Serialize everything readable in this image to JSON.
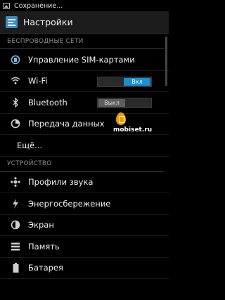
{
  "statusbar": {
    "text": "Сохранение...",
    "icon": "image-icon"
  },
  "actionbar": {
    "title": "Настройки",
    "icon": "settings-icon"
  },
  "sections": [
    {
      "header": "БЕСПРОВОДНЫЕ СЕТИ",
      "items": [
        {
          "label": "Управление SIM-картами",
          "icon": "sim-icon"
        },
        {
          "label": "Wi-Fi",
          "icon": "wifi-icon",
          "toggle": {
            "state": "on",
            "label": "Вкл"
          }
        },
        {
          "label": "Bluetooth",
          "icon": "bluetooth-icon",
          "toggle": {
            "state": "off",
            "label": "Выкл"
          }
        },
        {
          "label": "Передача данных",
          "icon": "data-usage-icon"
        },
        {
          "label": "Ещё...",
          "icon": ""
        }
      ]
    },
    {
      "header": "УСТРОЙСТВО",
      "items": [
        {
          "label": "Профили звука",
          "icon": "sound-profile-icon"
        },
        {
          "label": "Энергосбережение",
          "icon": "power-saving-icon"
        },
        {
          "label": "Экран",
          "icon": "display-icon"
        },
        {
          "label": "Память",
          "icon": "storage-icon"
        },
        {
          "label": "Батарея",
          "icon": "battery-icon"
        }
      ]
    }
  ],
  "watermark": {
    "text": "mobiset.ru",
    "color": "#f29a00"
  },
  "colors": {
    "accent": "#1b8fd0",
    "background": "#000000",
    "actionbar": "#1c1c1c"
  }
}
